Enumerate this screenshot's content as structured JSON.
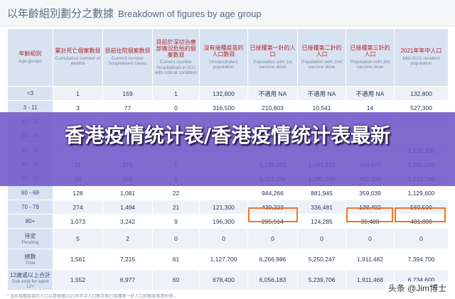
{
  "title": {
    "zh": "以年齡組別劃分之數據",
    "en": "Breakdown of figures by age group"
  },
  "headers": [
    {
      "zh": "年齡組別",
      "en": "Age groups"
    },
    {
      "zh": "累計死亡個案數目",
      "en": "Cumulative number of deaths"
    },
    {
      "zh": "目前住院個案數目",
      "en": "Current number hospitalised cases"
    },
    {
      "zh": "目前於深切治療部情況危殆的個案數目",
      "en": "Current number hospitalised in ICU with critical condition"
    },
    {
      "zh": "沒有接種疫苗的人口數目",
      "en": "Unvaccinated population"
    },
    {
      "zh": "已接種第一針的人口",
      "en": "Population with 1st vaccine dose"
    },
    {
      "zh": "已接種第二針的人口",
      "en": "Population with 2nd vaccine dose"
    },
    {
      "zh": "已接種第三針的人口",
      "en": "Population with 3rd vaccine dose"
    },
    {
      "zh": "2021年年中人口",
      "en": "Mid-2021 resident population"
    }
  ],
  "rows": [
    {
      "age": "<3",
      "cells": [
        "1",
        "159",
        "1",
        "132,800",
        "不適用 NA",
        "不適用 NA",
        "不適用 NA",
        "132,800"
      ]
    },
    {
      "age": "3 - 11",
      "cells": [
        "3",
        "77",
        "0",
        "316,500",
        "210,803",
        "10,541",
        "14",
        "527,300"
      ]
    },
    {
      "age": "12 - 19",
      "cells": [
        "",
        "",
        "",
        "",
        "",
        "",
        "",
        ""
      ]
    },
    {
      "age": "20 - 29",
      "cells": [
        "",
        "",
        "",
        "",
        "",
        "",
        "",
        ""
      ]
    },
    {
      "age": "30 - 39",
      "cells": [
        "",
        "",
        "",
        "",
        "",
        "",
        "",
        "1,126,300"
      ]
    },
    {
      "age": "40 - 49",
      "cells": [
        "11",
        "274",
        "1",
        "",
        "1,136,033",
        "1,043,871",
        "454,677",
        "1,161,000"
      ]
    },
    {
      "age": "50 - 59",
      "cells": [
        "59",
        "551",
        "6",
        "",
        "1,154,036",
        "1,080,868",
        "462,436",
        "1,233,700"
      ]
    },
    {
      "age": "60 - 69",
      "cells": [
        "128",
        "1,081",
        "22",
        "",
        "944,266",
        "881,945",
        "359,039",
        "1,129,600"
      ]
    },
    {
      "age": "70 - 79",
      "cells": [
        "274",
        "1,494",
        "21",
        "121,300",
        "439,223",
        "336,481",
        "138,492",
        "560,500"
      ]
    },
    {
      "age": "80+",
      "cells": [
        "1,073",
        "3,242",
        "9",
        "196,300",
        "205,514",
        "124,285",
        "30,408",
        "401,800"
      ]
    },
    {
      "age": "待定",
      "age_en": "Pending",
      "cells": [
        "5",
        "2",
        "0",
        "0",
        "0",
        "0",
        "0",
        "0"
      ]
    },
    {
      "age": "總數",
      "age_en": "Total",
      "cells": [
        "1,561",
        "7,215",
        "61",
        "1,127,700",
        "6,266,986",
        "5,250,247",
        "1,911,482",
        "7,394,700"
      ]
    },
    {
      "age": "12歲或以上合計",
      "age_en": "Sub-total for aged 12+",
      "cells": [
        "1,552",
        "6,977",
        "60",
        "678,400",
        "6,056,183",
        "5,239,706",
        "1,911,468",
        "6,734,600"
      ]
    }
  ],
  "footnote": "* 沒有接種疫苗的人口以是根據2021年年中人口數字和已接種第一針人口的概差推算所得 。",
  "banner": "香港疫情统计表/香港疫情统计表最新",
  "watermark": "头条 @Jim博士",
  "colors": {
    "highlight": "#e8782c",
    "banner": "#7056c8",
    "header": "#d8e3f2",
    "header_text": "#b3242a"
  }
}
